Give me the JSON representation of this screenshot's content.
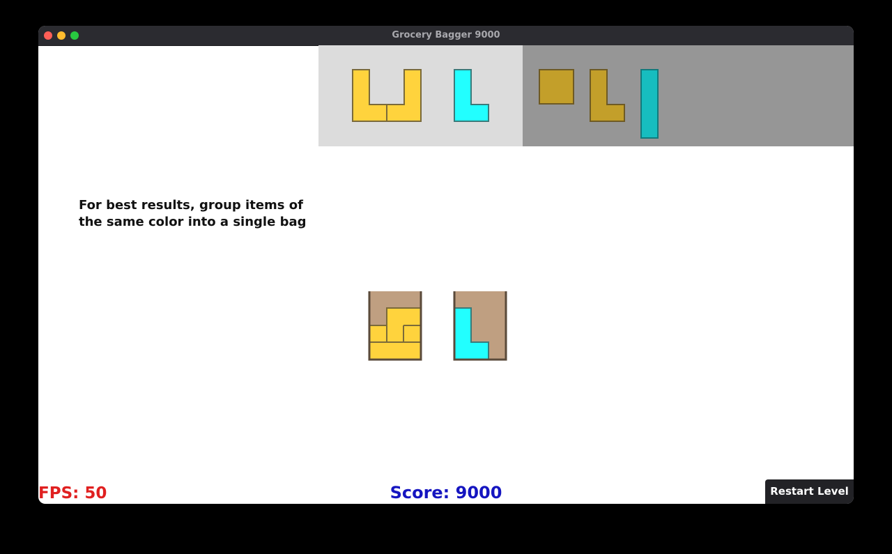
{
  "window": {
    "title": "Grocery Bagger 9000"
  },
  "hint": {
    "line1": "For best results, group items of",
    "line2": "the same color into a single bag"
  },
  "hud": {
    "fps_label": "FPS: 50",
    "score_label": "Score: 9000",
    "restart_label": "Restart Level"
  },
  "colors": {
    "yellow": "#ffd33d",
    "yellow_dim": "#c39f2a",
    "cyan": "#22ffff",
    "cyan_dim": "#17bdbf",
    "bag": "#bf9f81",
    "bag_border": "#5a4a3a",
    "tray_light": "#dcdcdc",
    "tray_dark": "#969696"
  },
  "tray_items": [
    {
      "name": "yellow-u-piece",
      "color": "yellow",
      "state": "available"
    },
    {
      "name": "cyan-l-piece",
      "color": "cyan",
      "state": "available"
    },
    {
      "name": "yellow-square-piece",
      "color": "yellow",
      "state": "used"
    },
    {
      "name": "yellow-l-piece",
      "color": "yellow",
      "state": "used"
    },
    {
      "name": "cyan-bar-piece",
      "color": "cyan",
      "state": "used"
    }
  ],
  "bags": [
    {
      "name": "bag-yellow",
      "contents": "yellow"
    },
    {
      "name": "bag-cyan",
      "contents": "cyan"
    }
  ]
}
